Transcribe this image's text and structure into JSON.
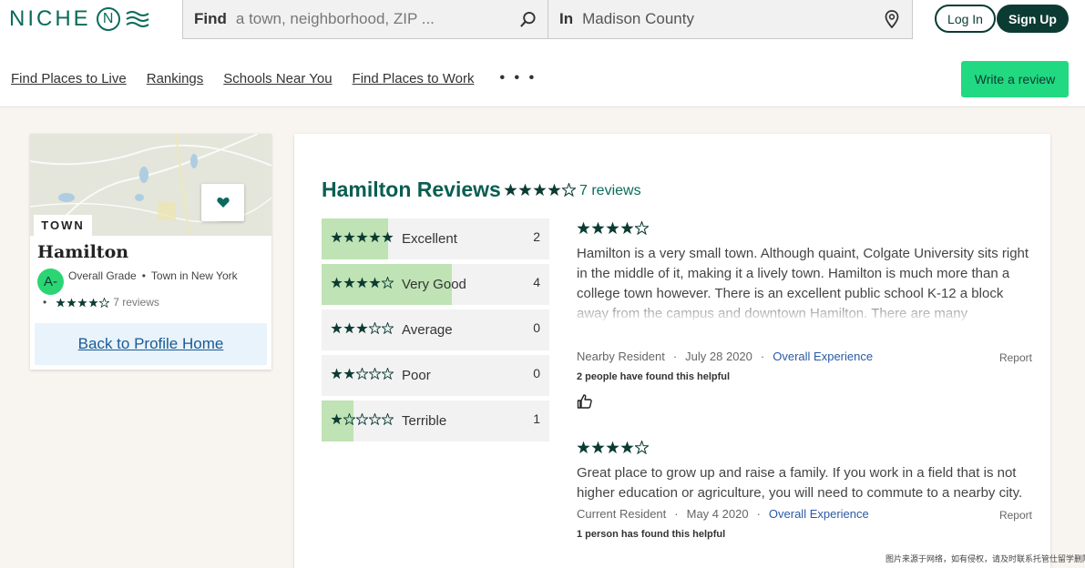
{
  "header": {
    "logo_text": "NICHE",
    "logo_mark": "N",
    "search": {
      "find_label": "Find",
      "find_placeholder": "a town, neighborhood, ZIP ...",
      "in_label": "In",
      "in_value": "Madison County"
    },
    "login_label": "Log In",
    "signup_label": "Sign Up"
  },
  "nav": {
    "items": [
      "Find Places to Live",
      "Rankings",
      "Schools Near You",
      "Find Places to Work"
    ],
    "more": "• • •",
    "write_review": "Write a review"
  },
  "profile": {
    "tag": "TOWN",
    "name": "Hamilton",
    "grade": "A-",
    "grade_label": "Overall Grade",
    "place_type": "Town in New York",
    "rating_stars": 4,
    "reviews_link": "7 reviews",
    "back_link": "Back to Profile Home"
  },
  "reviews": {
    "title": "Hamilton Reviews",
    "rating_stars": 4,
    "count_label": "7 reviews",
    "breakdown": [
      {
        "stars": 5,
        "label": "Excellent",
        "count": "2",
        "fraction": 0.29
      },
      {
        "stars": 4,
        "label": "Very Good",
        "count": "4",
        "fraction": 0.57
      },
      {
        "stars": 3,
        "label": "Average",
        "count": "0",
        "fraction": 0
      },
      {
        "stars": 2,
        "label": "Poor",
        "count": "0",
        "fraction": 0
      },
      {
        "stars": 1,
        "label": "Terrible",
        "count": "1",
        "fraction": 0.14
      }
    ],
    "items": [
      {
        "stars": 4,
        "text": "Hamilton is a very small town. Although quaint, Colgate University sits right in the middle of it, making it a lively town. Hamilton is much more than a college town however. There is an excellent public school K-12 a block away from the campus and downtown Hamilton. There are many",
        "author": "Nearby Resident",
        "date": "July 28 2020",
        "category": "Overall Experience",
        "report": "Report",
        "helpful": "2 people have found this helpful"
      },
      {
        "stars": 4,
        "text": "Great place to grow up and raise a family. If you work in a field that is not higher education or agriculture, you will need to commute to a nearby city.",
        "author": "Current Resident",
        "date": "May 4 2020",
        "category": "Overall Experience",
        "report": "Report",
        "helpful": "1 person has found this helpful"
      }
    ]
  },
  "watermark": "图片来源于网络，如有侵权，请及时联系托管仕留学删除",
  "colors": {
    "brand_dark": "#0c3b33",
    "brand_green": "#0a6b5b",
    "accent_green": "#21d980",
    "bar_fill": "#bfe3b4",
    "link_blue": "#1a5a96"
  },
  "icons": {
    "search": "magnifier-icon",
    "location": "map-pin-icon",
    "favorite": "heart-icon",
    "helpful": "thumbs-up-icon",
    "star": "star-icon"
  }
}
